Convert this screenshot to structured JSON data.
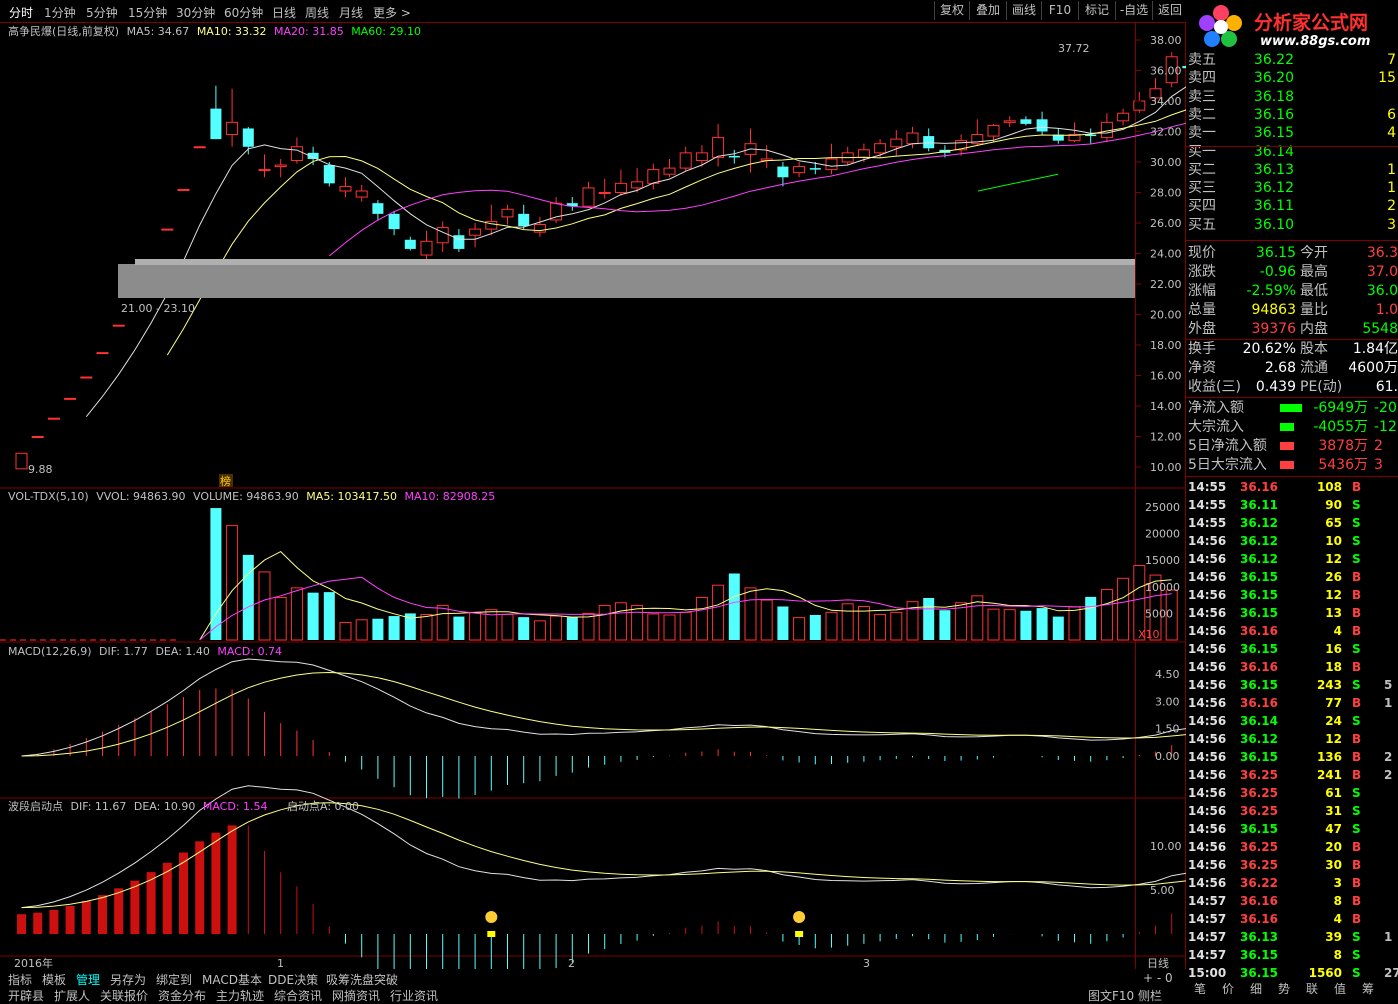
{
  "toolbar": {
    "periods": [
      "分时",
      "1分钟",
      "5分钟",
      "15分钟",
      "30分钟",
      "60分钟",
      "日线",
      "周线",
      "月线",
      "更多 >"
    ],
    "active_index": 0,
    "right_buttons": [
      "复权",
      "叠加",
      "画线",
      "F10",
      "标记",
      "-自选",
      "返回"
    ]
  },
  "logo": {
    "name": "分析家公式网",
    "url": "www.88gs.com"
  },
  "main_panel": {
    "title": "高争民爆(日线,前复权)",
    "ma5": "MA5: 34.67",
    "ma10": "MA10: 33.32",
    "ma20": "MA20: 31.85",
    "ma60": "MA60: 29.10",
    "max_label": "37.72",
    "min_label": "9.88",
    "range_label": "21.00 - 23.10",
    "y_ticks": [
      "38.00",
      "36.00",
      "34.00",
      "32.00",
      "30.00",
      "28.00",
      "26.00",
      "24.00",
      "22.00",
      "20.00",
      "18.00",
      "16.00",
      "14.00",
      "12.00",
      "10.00"
    ],
    "badge": "榜"
  },
  "vol_panel": {
    "title": "VOL-TDX(5,10)",
    "vvol": "VVOL: 94863.90",
    "volume": "VOLUME: 94863.90",
    "ma5": "MA5: 103417.50",
    "ma10": "MA10: 82908.25",
    "y_ticks": [
      "25000",
      "20000",
      "15000",
      "10000",
      "5000"
    ],
    "unit": "X10"
  },
  "macd_panel": {
    "title": "MACD(12,26,9)",
    "dif": "DIF: 1.77",
    "dea": "DEA: 1.40",
    "macd": "MACD: 0.74",
    "y_ticks": [
      "4.50",
      "3.00",
      "1.50",
      "0.00"
    ]
  },
  "wave_panel": {
    "title": "波段启动点",
    "dif": "DIF: 11.67",
    "dea": "DEA: 10.90",
    "macd": "MACD: 1.54",
    "start": "启动点A: 0.00",
    "y_ticks": [
      "10.00",
      "5.00"
    ]
  },
  "time_axis": [
    "2016年",
    "1",
    "2",
    "3"
  ],
  "period_label": "日线",
  "bottom_tabs": [
    "指标",
    "模板",
    "管理",
    "另存为",
    "绑定到",
    "MACD基本",
    "DDE决策",
    "吸筹洗盘突破"
  ],
  "bottom_tabs2": [
    "开辟县",
    "扩展人",
    "关联报价",
    "资金分布",
    "主力轨迹",
    "综合资讯",
    "网摘资讯",
    "行业资讯"
  ],
  "bottom_right": [
    "图文F10",
    "侧栏"
  ],
  "order_book": [
    {
      "label": "卖五",
      "price": "36.22",
      "vol": "7"
    },
    {
      "label": "卖四",
      "price": "36.20",
      "vol": "15"
    },
    {
      "label": "卖三",
      "price": "36.18",
      "vol": ""
    },
    {
      "label": "卖二",
      "price": "36.16",
      "vol": "6"
    },
    {
      "label": "卖一",
      "price": "36.15",
      "vol": "4"
    },
    {
      "label": "买一",
      "price": "36.14",
      "vol": ""
    },
    {
      "label": "买二",
      "price": "36.13",
      "vol": "1"
    },
    {
      "label": "买三",
      "price": "36.12",
      "vol": "1"
    },
    {
      "label": "买四",
      "price": "36.11",
      "vol": "2"
    },
    {
      "label": "买五",
      "price": "36.10",
      "vol": "3"
    }
  ],
  "quote": [
    {
      "l1": "现价",
      "v1": "36.15",
      "l2": "今开",
      "v2": "36.3",
      "c1": "#00ff00",
      "c2": "#ff4040"
    },
    {
      "l1": "涨跌",
      "v1": "-0.96",
      "l2": "最高",
      "v2": "37.0",
      "c1": "#00ff00",
      "c2": "#ff4040"
    },
    {
      "l1": "涨幅",
      "v1": "-2.59%",
      "l2": "最低",
      "v2": "36.0",
      "c1": "#00ff00",
      "c2": "#00ff00"
    },
    {
      "l1": "总量",
      "v1": "94863",
      "l2": "量比",
      "v2": "1.0",
      "c1": "#ffff00",
      "c2": "#ff4040"
    },
    {
      "l1": "外盘",
      "v1": "39376",
      "l2": "内盘",
      "v2": "5548",
      "c1": "#ff4040",
      "c2": "#00ff00"
    },
    {
      "l1": "换手",
      "v1": "20.62%",
      "l2": "股本",
      "v2": "1.84亿",
      "c1": "#ffffff",
      "c2": "#ffffff"
    },
    {
      "l1": "净资",
      "v1": "2.68",
      "l2": "流通",
      "v2": "4600万",
      "c1": "#ffffff",
      "c2": "#ffffff"
    },
    {
      "l1": "收益(三)",
      "v1": "0.439",
      "l2": "PE(动)",
      "v2": "61.",
      "c1": "#ffffff",
      "c2": "#ffffff"
    }
  ],
  "flow": [
    {
      "label": "净流入额",
      "value": "-6949万",
      "extra": "-20",
      "color": "#00ff00"
    },
    {
      "label": "大宗流入",
      "value": "-4055万",
      "extra": "-12",
      "color": "#00ff00"
    },
    {
      "label": "5日净流入额",
      "value": "3878万",
      "extra": "2",
      "color": "#ff4040"
    },
    {
      "label": "5日大宗流入",
      "value": "5436万",
      "extra": "3",
      "color": "#ff4040"
    }
  ],
  "ticks": [
    {
      "time": "14:55",
      "price": "36.16",
      "vol": "108",
      "bs": "B",
      "x": ""
    },
    {
      "time": "14:55",
      "price": "36.11",
      "vol": "90",
      "bs": "S",
      "x": ""
    },
    {
      "time": "14:55",
      "price": "36.12",
      "vol": "65",
      "bs": "S",
      "x": ""
    },
    {
      "time": "14:56",
      "price": "36.12",
      "vol": "10",
      "bs": "S",
      "x": ""
    },
    {
      "time": "14:56",
      "price": "36.12",
      "vol": "12",
      "bs": "S",
      "x": ""
    },
    {
      "time": "14:56",
      "price": "36.15",
      "vol": "26",
      "bs": "B",
      "x": ""
    },
    {
      "time": "14:56",
      "price": "36.15",
      "vol": "12",
      "bs": "B",
      "x": ""
    },
    {
      "time": "14:56",
      "price": "36.15",
      "vol": "13",
      "bs": "B",
      "x": ""
    },
    {
      "time": "14:56",
      "price": "36.16",
      "vol": "4",
      "bs": "B",
      "x": ""
    },
    {
      "time": "14:56",
      "price": "36.15",
      "vol": "16",
      "bs": "S",
      "x": ""
    },
    {
      "time": "14:56",
      "price": "36.16",
      "vol": "18",
      "bs": "B",
      "x": ""
    },
    {
      "time": "14:56",
      "price": "36.15",
      "vol": "243",
      "bs": "S",
      "x": "5"
    },
    {
      "time": "14:56",
      "price": "36.16",
      "vol": "77",
      "bs": "B",
      "x": "1"
    },
    {
      "time": "14:56",
      "price": "36.14",
      "vol": "24",
      "bs": "S",
      "x": ""
    },
    {
      "time": "14:56",
      "price": "36.12",
      "vol": "12",
      "bs": "B",
      "x": ""
    },
    {
      "time": "14:56",
      "price": "36.15",
      "vol": "136",
      "bs": "B",
      "x": "2"
    },
    {
      "time": "14:56",
      "price": "36.25",
      "vol": "241",
      "bs": "B",
      "x": "2"
    },
    {
      "time": "14:56",
      "price": "36.25",
      "vol": "61",
      "bs": "S",
      "x": ""
    },
    {
      "time": "14:56",
      "price": "36.25",
      "vol": "31",
      "bs": "S",
      "x": ""
    },
    {
      "time": "14:56",
      "price": "36.15",
      "vol": "47",
      "bs": "S",
      "x": ""
    },
    {
      "time": "14:56",
      "price": "36.25",
      "vol": "20",
      "bs": "B",
      "x": ""
    },
    {
      "time": "14:56",
      "price": "36.25",
      "vol": "30",
      "bs": "B",
      "x": ""
    },
    {
      "time": "14:56",
      "price": "36.22",
      "vol": "3",
      "bs": "B",
      "x": ""
    },
    {
      "time": "14:57",
      "price": "36.16",
      "vol": "8",
      "bs": "B",
      "x": ""
    },
    {
      "time": "14:57",
      "price": "36.16",
      "vol": "4",
      "bs": "B",
      "x": ""
    },
    {
      "time": "14:57",
      "price": "36.13",
      "vol": "39",
      "bs": "S",
      "x": "1"
    },
    {
      "time": "14:57",
      "price": "36.15",
      "vol": "8",
      "bs": "S",
      "x": ""
    },
    {
      "time": "15:00",
      "price": "36.15",
      "vol": "1560",
      "bs": "S",
      "x": "27"
    }
  ],
  "ticks_footer": [
    "笔",
    "价",
    "细",
    "势",
    "联",
    "值",
    "筹"
  ],
  "chart_data": {
    "type": "candlestick",
    "candles": [
      [
        9.88,
        10.9,
        9.88,
        10.9
      ],
      [
        12.0,
        12.0,
        12.0,
        12.0
      ],
      [
        13.2,
        13.2,
        13.2,
        13.2
      ],
      [
        14.5,
        14.5,
        14.5,
        14.5
      ],
      [
        15.9,
        15.9,
        15.9,
        15.9
      ],
      [
        17.5,
        17.5,
        17.5,
        17.5
      ],
      [
        19.3,
        19.3,
        19.3,
        19.3
      ],
      [
        21.2,
        21.2,
        21.2,
        21.2
      ],
      [
        23.3,
        23.3,
        23.3,
        23.3
      ],
      [
        25.6,
        25.6,
        25.6,
        25.6
      ],
      [
        28.2,
        28.2,
        28.2,
        28.2
      ],
      [
        31.0,
        31.0,
        31.0,
        31.0
      ],
      [
        33.5,
        31.5,
        31.5,
        35.0
      ],
      [
        31.8,
        32.6,
        31.0,
        34.8
      ],
      [
        32.2,
        31.0,
        30.5,
        32.3
      ],
      [
        29.5,
        29.5,
        29.0,
        30.5
      ],
      [
        29.7,
        29.8,
        29.0,
        30.2
      ],
      [
        30.1,
        31.0,
        29.9,
        31.6
      ],
      [
        30.6,
        30.2,
        29.8,
        31.0
      ],
      [
        29.8,
        28.6,
        28.4,
        30.0
      ],
      [
        28.1,
        28.4,
        27.7,
        29.0
      ],
      [
        27.7,
        28.1,
        27.4,
        28.5
      ],
      [
        27.3,
        26.6,
        26.2,
        27.5
      ],
      [
        26.6,
        25.6,
        25.2,
        26.8
      ],
      [
        24.9,
        24.3,
        24.2,
        25.1
      ],
      [
        23.9,
        24.8,
        23.6,
        25.5
      ],
      [
        24.7,
        25.7,
        24.1,
        26.1
      ],
      [
        25.2,
        24.3,
        24.1,
        25.6
      ],
      [
        25.2,
        25.6,
        24.4,
        26.0
      ],
      [
        25.6,
        26.1,
        25.2,
        27.2
      ],
      [
        26.4,
        26.9,
        25.9,
        27.2
      ],
      [
        26.6,
        25.8,
        25.6,
        27.2
      ],
      [
        25.4,
        25.9,
        25.1,
        26.4
      ],
      [
        26.2,
        27.3,
        26.0,
        27.7
      ],
      [
        27.3,
        27.1,
        26.8,
        27.7
      ],
      [
        27.1,
        28.3,
        27.0,
        28.7
      ],
      [
        28.0,
        28.0,
        27.6,
        28.9
      ],
      [
        28.0,
        28.6,
        27.8,
        29.5
      ],
      [
        28.3,
        28.7,
        28.0,
        29.6
      ],
      [
        28.6,
        29.5,
        28.2,
        29.9
      ],
      [
        29.2,
        29.6,
        29.0,
        30.2
      ],
      [
        29.6,
        30.6,
        29.4,
        31.0
      ],
      [
        30.1,
        30.6,
        29.7,
        31.1
      ],
      [
        30.3,
        31.6,
        29.7,
        32.5
      ],
      [
        30.4,
        30.3,
        29.9,
        30.8
      ],
      [
        30.5,
        31.2,
        29.3,
        32.2
      ],
      [
        30.1,
        30.2,
        29.6,
        31.1
      ],
      [
        29.7,
        29.0,
        28.4,
        30.0
      ],
      [
        29.3,
        29.7,
        29.0,
        30.0
      ],
      [
        29.6,
        29.5,
        29.2,
        30.0
      ],
      [
        29.5,
        30.2,
        29.2,
        31.2
      ],
      [
        30.0,
        30.6,
        29.8,
        31.0
      ],
      [
        30.3,
        30.8,
        30.0,
        31.2
      ],
      [
        30.6,
        31.2,
        30.3,
        31.5
      ],
      [
        31.0,
        31.5,
        30.4,
        32.1
      ],
      [
        31.2,
        31.9,
        30.9,
        32.3
      ],
      [
        31.7,
        30.9,
        30.7,
        32.2
      ],
      [
        30.8,
        30.6,
        30.3,
        31.1
      ],
      [
        30.8,
        31.4,
        30.4,
        31.8
      ],
      [
        31.2,
        31.8,
        31.1,
        32.8
      ],
      [
        31.7,
        32.4,
        31.3,
        32.5
      ],
      [
        32.6,
        32.7,
        32.3,
        33.0
      ],
      [
        32.8,
        32.5,
        32.4,
        33.0
      ],
      [
        32.8,
        32.0,
        31.8,
        33.3
      ],
      [
        31.8,
        31.4,
        31.2,
        32.2
      ],
      [
        31.4,
        31.8,
        31.3,
        32.6
      ],
      [
        31.8,
        31.7,
        31.2,
        32.2
      ],
      [
        31.6,
        32.6,
        31.3,
        33.2
      ],
      [
        32.7,
        33.2,
        32.4,
        33.5
      ],
      [
        33.4,
        34.0,
        33.2,
        34.6
      ],
      [
        34.2,
        34.8,
        33.8,
        35.5
      ],
      [
        35.2,
        36.9,
        34.9,
        37.2
      ],
      [
        36.3,
        36.15,
        36.0,
        37.0
      ]
    ],
    "volume": [
      0,
      0,
      0,
      0,
      0,
      0,
      0,
      0,
      0,
      0,
      0,
      0,
      24800,
      21500,
      16000,
      12800,
      8000,
      9800,
      8900,
      9000,
      3300,
      3800,
      4000,
      4500,
      5000,
      4800,
      6500,
      4400,
      5200,
      5700,
      4800,
      4300,
      3600,
      4500,
      4300,
      5000,
      6500,
      7000,
      6500,
      4900,
      4700,
      5200,
      8000,
      10300,
      12500,
      9800,
      7500,
      6300,
      4200,
      4700,
      5200,
      6800,
      6300,
      4800,
      5200,
      7200,
      7900,
      5600,
      7000,
      8300,
      5800,
      5700,
      5500,
      6000,
      4400,
      6200,
      8100,
      9500,
      11600,
      14000,
      12200,
      9400
    ],
    "vol_ma5_label": "MA5: 103417.50",
    "vol_ma10_label": "MA10: 82908.25"
  }
}
